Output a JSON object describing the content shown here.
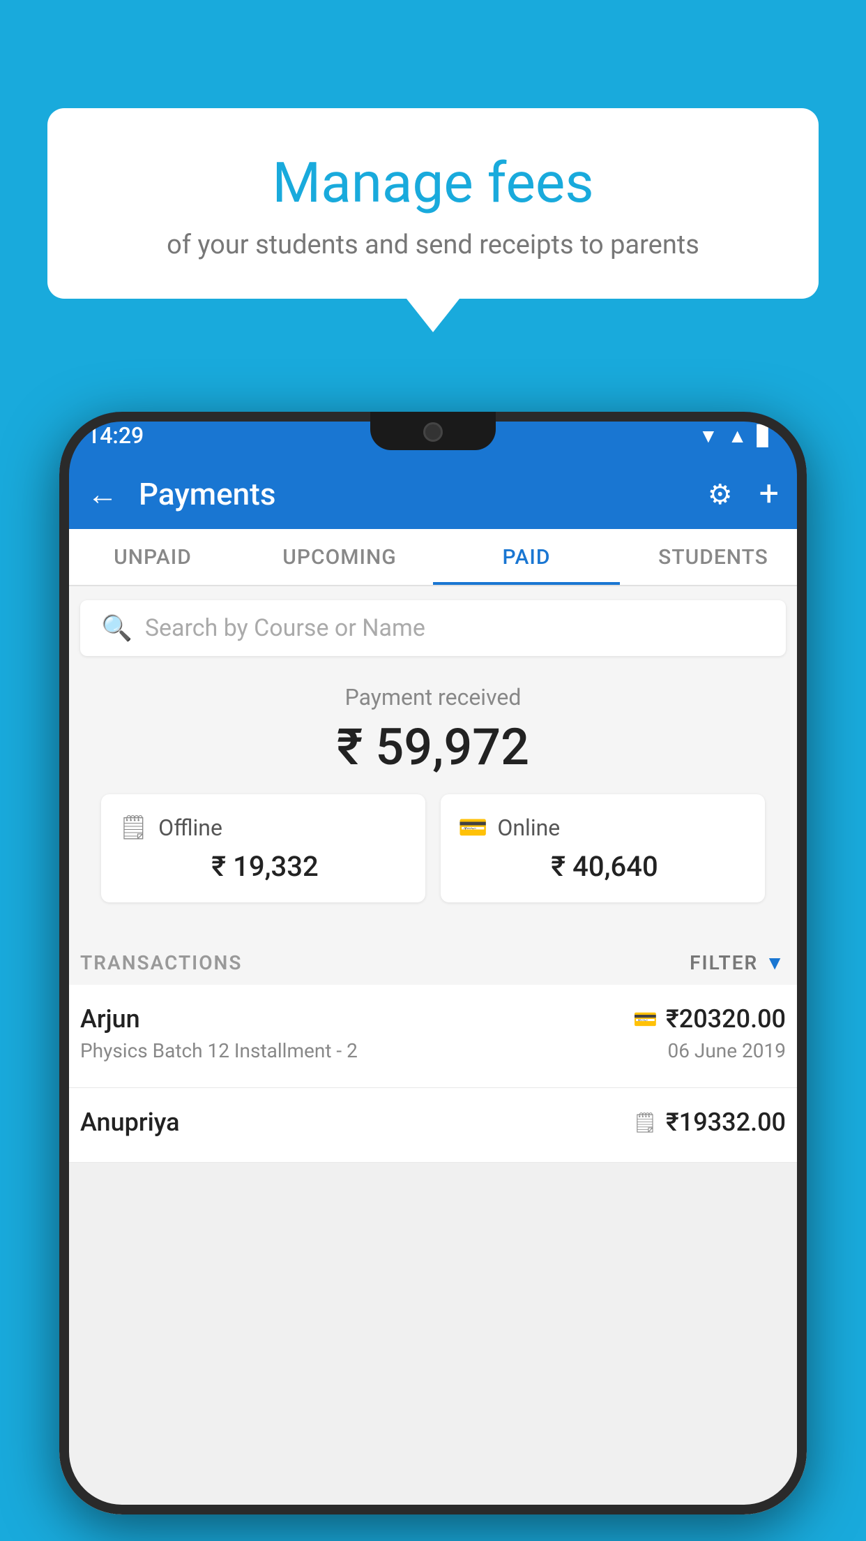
{
  "background_color": "#19AADC",
  "speech_bubble": {
    "title": "Manage fees",
    "subtitle": "of your students and send receipts to parents"
  },
  "status_bar": {
    "time": "14:29",
    "wifi_icon": "▲",
    "signal_icon": "▲",
    "battery_icon": "▊"
  },
  "header": {
    "title": "Payments",
    "back_icon": "←",
    "gear_icon": "⚙",
    "plus_icon": "+"
  },
  "tabs": [
    {
      "label": "UNPAID",
      "active": false
    },
    {
      "label": "UPCOMING",
      "active": false
    },
    {
      "label": "PAID",
      "active": true
    },
    {
      "label": "STUDENTS",
      "active": false
    }
  ],
  "search": {
    "placeholder": "Search by Course or Name"
  },
  "payment_summary": {
    "label": "Payment received",
    "amount": "₹ 59,972"
  },
  "payment_cards": [
    {
      "label": "Offline",
      "amount": "₹ 19,332",
      "icon": "💴"
    },
    {
      "label": "Online",
      "amount": "₹ 40,640",
      "icon": "💳"
    }
  ],
  "transactions_section": {
    "label": "TRANSACTIONS",
    "filter_label": "FILTER"
  },
  "transactions": [
    {
      "name": "Arjun",
      "course": "Physics Batch 12 Installment - 2",
      "amount": "₹20320.00",
      "date": "06 June 2019",
      "type_icon": "💳"
    },
    {
      "name": "Anupriya",
      "course": "",
      "amount": "₹19332.00",
      "date": "",
      "type_icon": "💴"
    }
  ]
}
